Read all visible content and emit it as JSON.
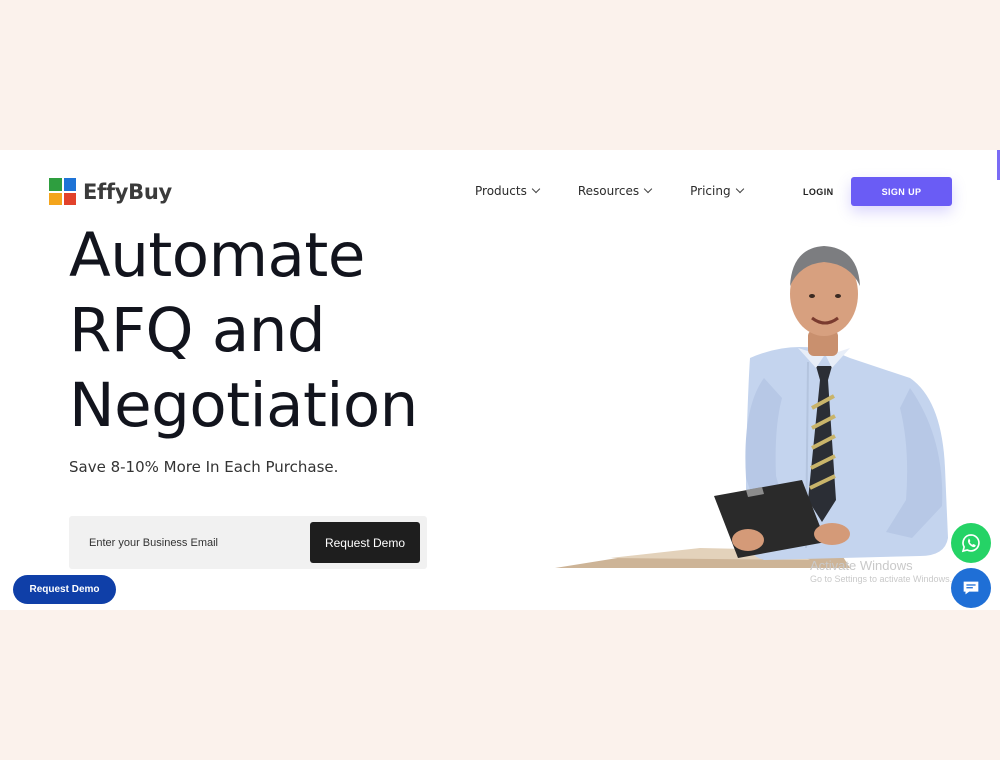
{
  "header": {
    "logo_text": "EffyBuy",
    "nav": [
      {
        "label": "Products"
      },
      {
        "label": "Resources"
      },
      {
        "label": "Pricing"
      }
    ],
    "login_label": "LOGIN",
    "signup_label": "SIGN UP"
  },
  "hero": {
    "title_line1": "Automate",
    "title_line2": "RFQ and",
    "title_line3": "Negotiation",
    "subtitle": "Save 8-10% More In Each Purchase.",
    "email_placeholder": "Enter your Business Email",
    "cta_label": "Request Demo"
  },
  "floating": {
    "request_demo_label": "Request Demo",
    "whatsapp_icon": "whatsapp-icon",
    "chat_icon": "chat-icon"
  },
  "watermark": {
    "line1": "Activate Windows",
    "line2": "Go to Settings to activate Windows."
  },
  "colors": {
    "accent": "#6a5cf5",
    "dark": "#1e1e1e",
    "floating_blue": "#0f3fa8",
    "whatsapp": "#25d366",
    "chat": "#1f6fd6",
    "highlight": "#fde9a8",
    "band": "#fbf2ec"
  }
}
